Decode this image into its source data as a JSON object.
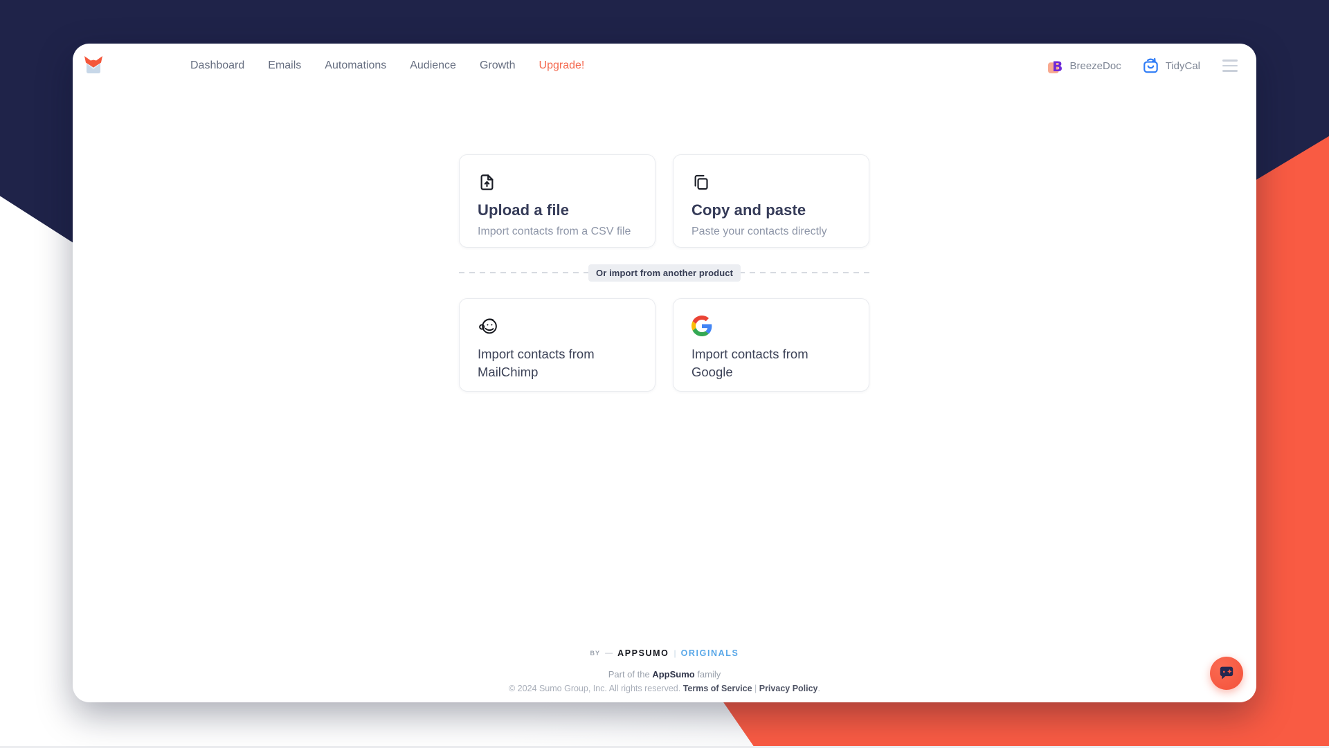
{
  "nav": {
    "items": [
      {
        "label": "Dashboard"
      },
      {
        "label": "Emails"
      },
      {
        "label": "Automations"
      },
      {
        "label": "Audience"
      },
      {
        "label": "Growth"
      }
    ],
    "upgrade": "Upgrade!",
    "products": [
      {
        "label": "BreezeDoc"
      },
      {
        "label": "TidyCal"
      }
    ]
  },
  "import": {
    "methods": [
      {
        "title": "Upload a file",
        "subtitle": "Import contacts from a CSV file",
        "icon": "file-upload-icon"
      },
      {
        "title": "Copy and paste",
        "subtitle": "Paste your contacts directly",
        "icon": "copy-icon"
      }
    ],
    "divider": "Or import from another product",
    "providers": [
      {
        "title": "Import contacts from MailChimp",
        "icon": "mailchimp-icon"
      },
      {
        "title": "Import contacts from Google",
        "icon": "google-icon"
      }
    ]
  },
  "footer": {
    "by": "BY",
    "dash": "—",
    "brand": "APPSUMO",
    "divider": "|",
    "originals": "ORIGINALS",
    "family_pre": "Part of the ",
    "family_brand": "AppSumo",
    "family_post": " family",
    "copyright": "© 2024 Sumo Group, Inc. All rights reserved. ",
    "terms": "Terms of Service",
    "sep": " | ",
    "privacy": "Privacy Policy",
    "period": "."
  },
  "colors": {
    "navy": "#1F2349",
    "orange": "#F95B43",
    "upgrade_text": "#F4684E",
    "title_text": "#363C59",
    "muted_text": "#8E96A8",
    "originals_blue": "#58A7E8"
  }
}
